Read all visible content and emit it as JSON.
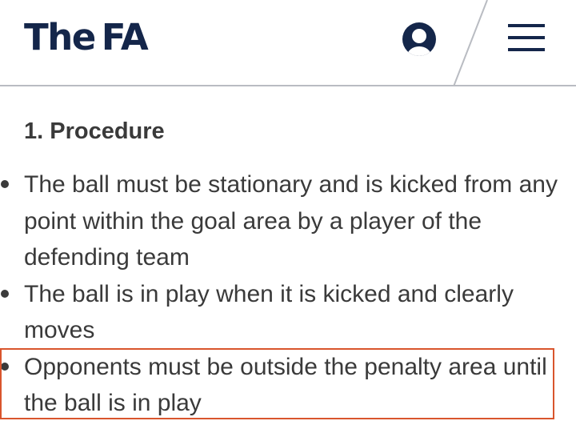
{
  "header": {
    "logo_the": "The",
    "logo_fa": "FA",
    "account_icon": "user-account-icon",
    "menu_icon": "hamburger-menu-icon",
    "brand_color": "#14264a"
  },
  "content": {
    "section_title": "1. Procedure",
    "bullets": [
      {
        "text": "The ball must be stationary and is kicked from any point within the goal area by a player of the defending team"
      },
      {
        "text": "The ball is in play when it is kicked and clearly moves"
      },
      {
        "text": "Opponents must be outside the penalty area until the ball is in play"
      }
    ],
    "highlight_color": "#d9552d",
    "highlighted_bullet": 2
  }
}
